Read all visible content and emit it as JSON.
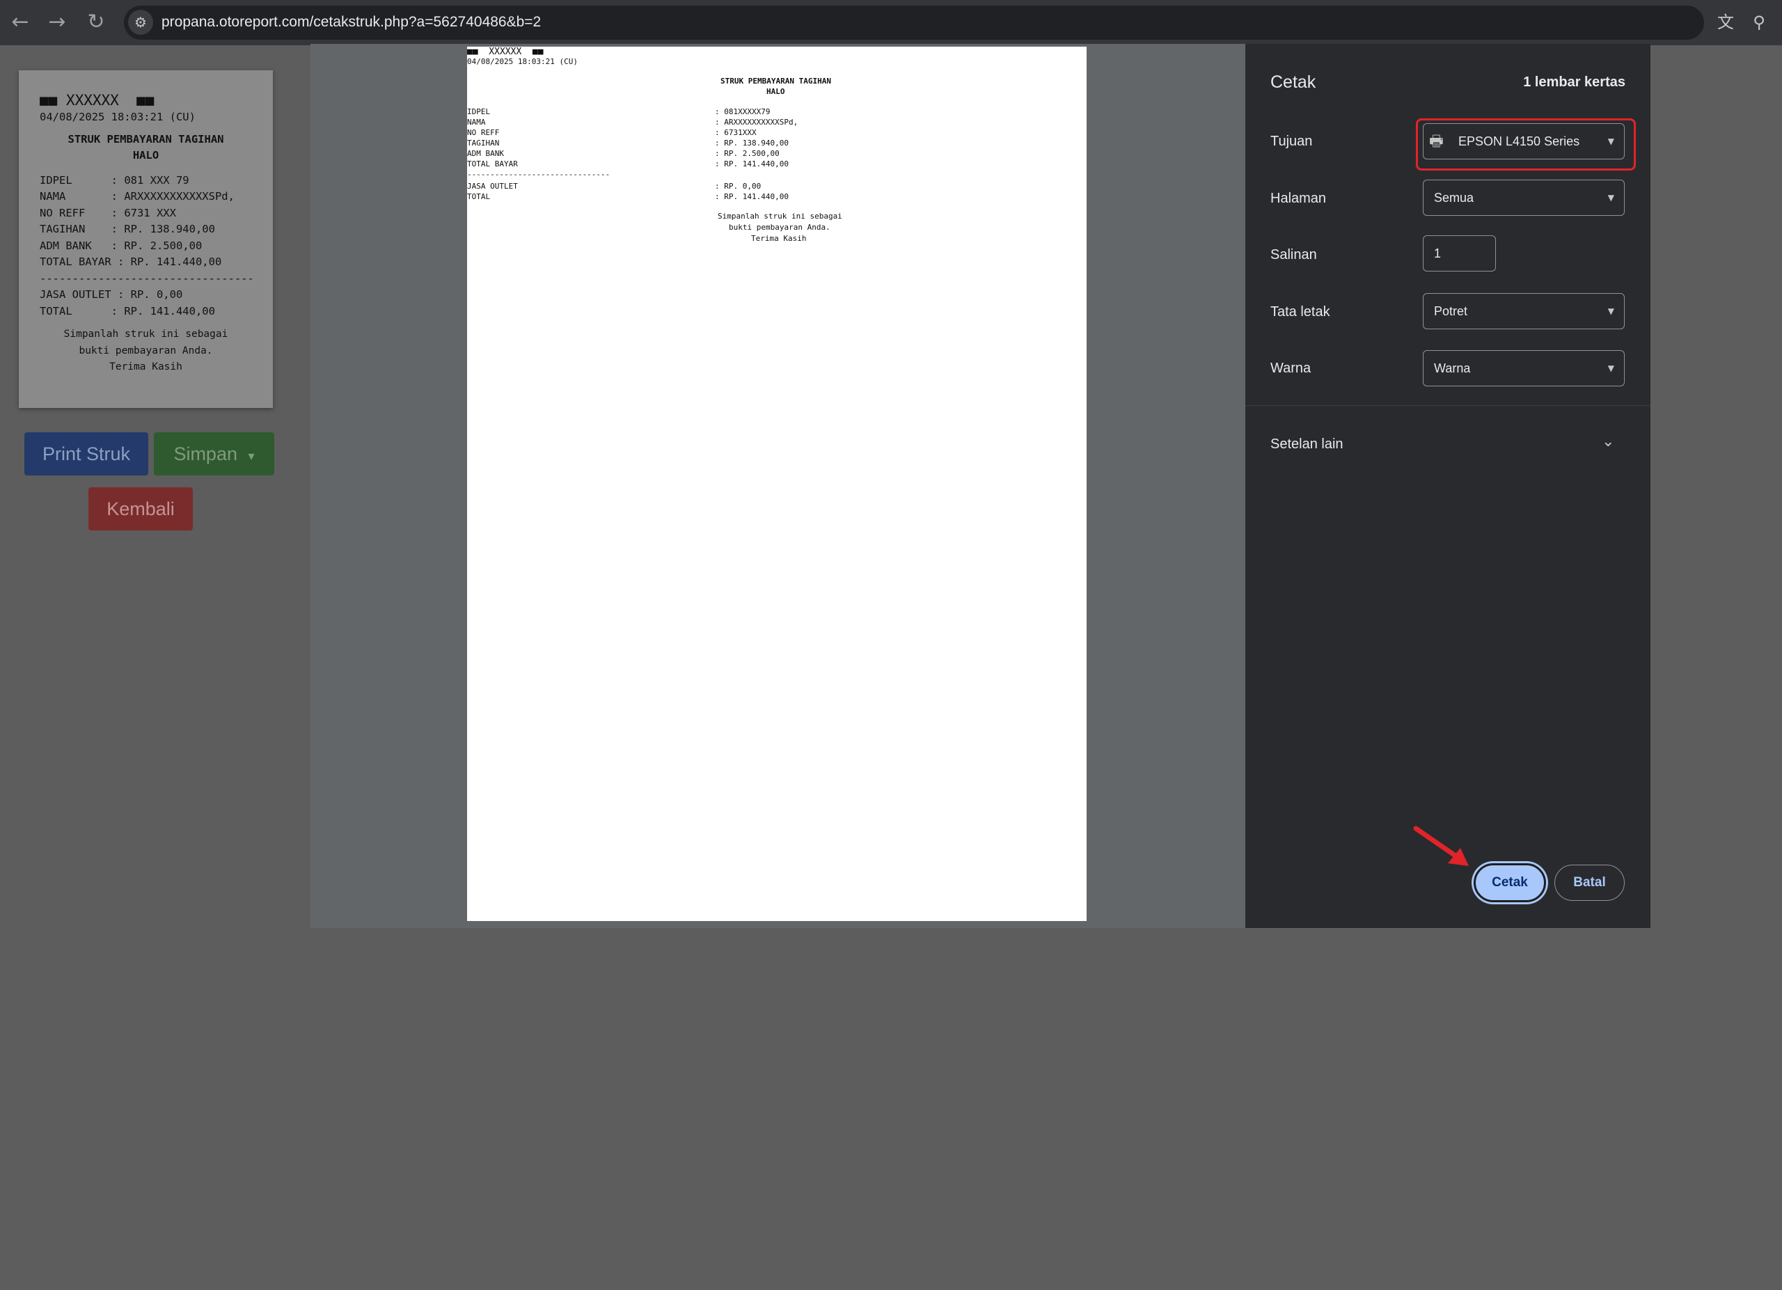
{
  "browser": {
    "url": "propana.otoreport.com/cetakstruk.php?a=562740486&b=2",
    "back_icon": "←",
    "forward_icon": "→",
    "reload_icon": "↻",
    "site_info_icon": "⚙",
    "translate_icon": "文",
    "zoom_icon": "⚲"
  },
  "receipt": {
    "header": "■■ XXXXXX  ■■",
    "datetime": "04/08/2025 18:03:21 (CU)",
    "title1": "STRUK PEMBAYARAN TAGIHAN",
    "title2": "HALO",
    "rows": [
      "IDPEL      : 081 XXX 79",
      "NAMA       : ARXXXXXXXXXXXSPd,",
      "NO REFF    : 6731 XXX",
      "TAGIHAN    : RP. 138.940,00",
      "ADM BANK   : RP. 2.500,00",
      "TOTAL BAYAR : RP. 141.440,00"
    ],
    "dashes": "----------------------------------------",
    "rows2": [
      "JASA OUTLET : RP. 0,00",
      "TOTAL      : RP. 141.440,00"
    ],
    "note1": "Simpanlah struk ini sebagai",
    "note2": "bukti pembayaran Anda.",
    "note3": "Terima Kasih"
  },
  "page_buttons": {
    "print": "Print Struk",
    "save": "Simpan",
    "save_caret": "▾",
    "back": "Kembali"
  },
  "preview": {
    "header": "■■  XXXXXX  ■■",
    "datetime": "04/08/2025 18:03:21 (CU)",
    "title1": "STRUK PEMBAYARAN TAGIHAN",
    "title2": "HALO",
    "labels": [
      "IDPEL",
      "NAMA",
      "NO REFF",
      "TAGIHAN",
      "ADM BANK",
      "TOTAL BAYAR"
    ],
    "values": [
      ": 081XXXXX79",
      ": ARXXXXXXXXXXSPd,",
      ": 6731XXX",
      ": RP. 138.940,00",
      ": RP. 2.500,00",
      ": RP. 141.440,00"
    ],
    "dashes": "-------------------------------",
    "labels2": [
      "JASA OUTLET",
      "TOTAL"
    ],
    "values2": [
      ": RP. 0,00",
      ": RP. 141.440,00"
    ],
    "note1": "Simpanlah struk ini sebagai",
    "note2": "bukti pembayaran Anda.",
    "note3": "Terima Kasih"
  },
  "print_dialog": {
    "title": "Cetak",
    "sheets": "1 lembar kertas",
    "destination_label": "Tujuan",
    "destination_value": "EPSON L4150 Series",
    "pages_label": "Halaman",
    "pages_value": "Semua",
    "copies_label": "Salinan",
    "copies_value": "1",
    "layout_label": "Tata letak",
    "layout_value": "Potret",
    "color_label": "Warna",
    "color_value": "Warna",
    "more_settings": "Setelan lain",
    "print_button": "Cetak",
    "cancel_button": "Batal",
    "printer_icon": "🖶",
    "caret": "▼",
    "chevron": "⌄",
    "highlight_color": "#e0242a"
  }
}
